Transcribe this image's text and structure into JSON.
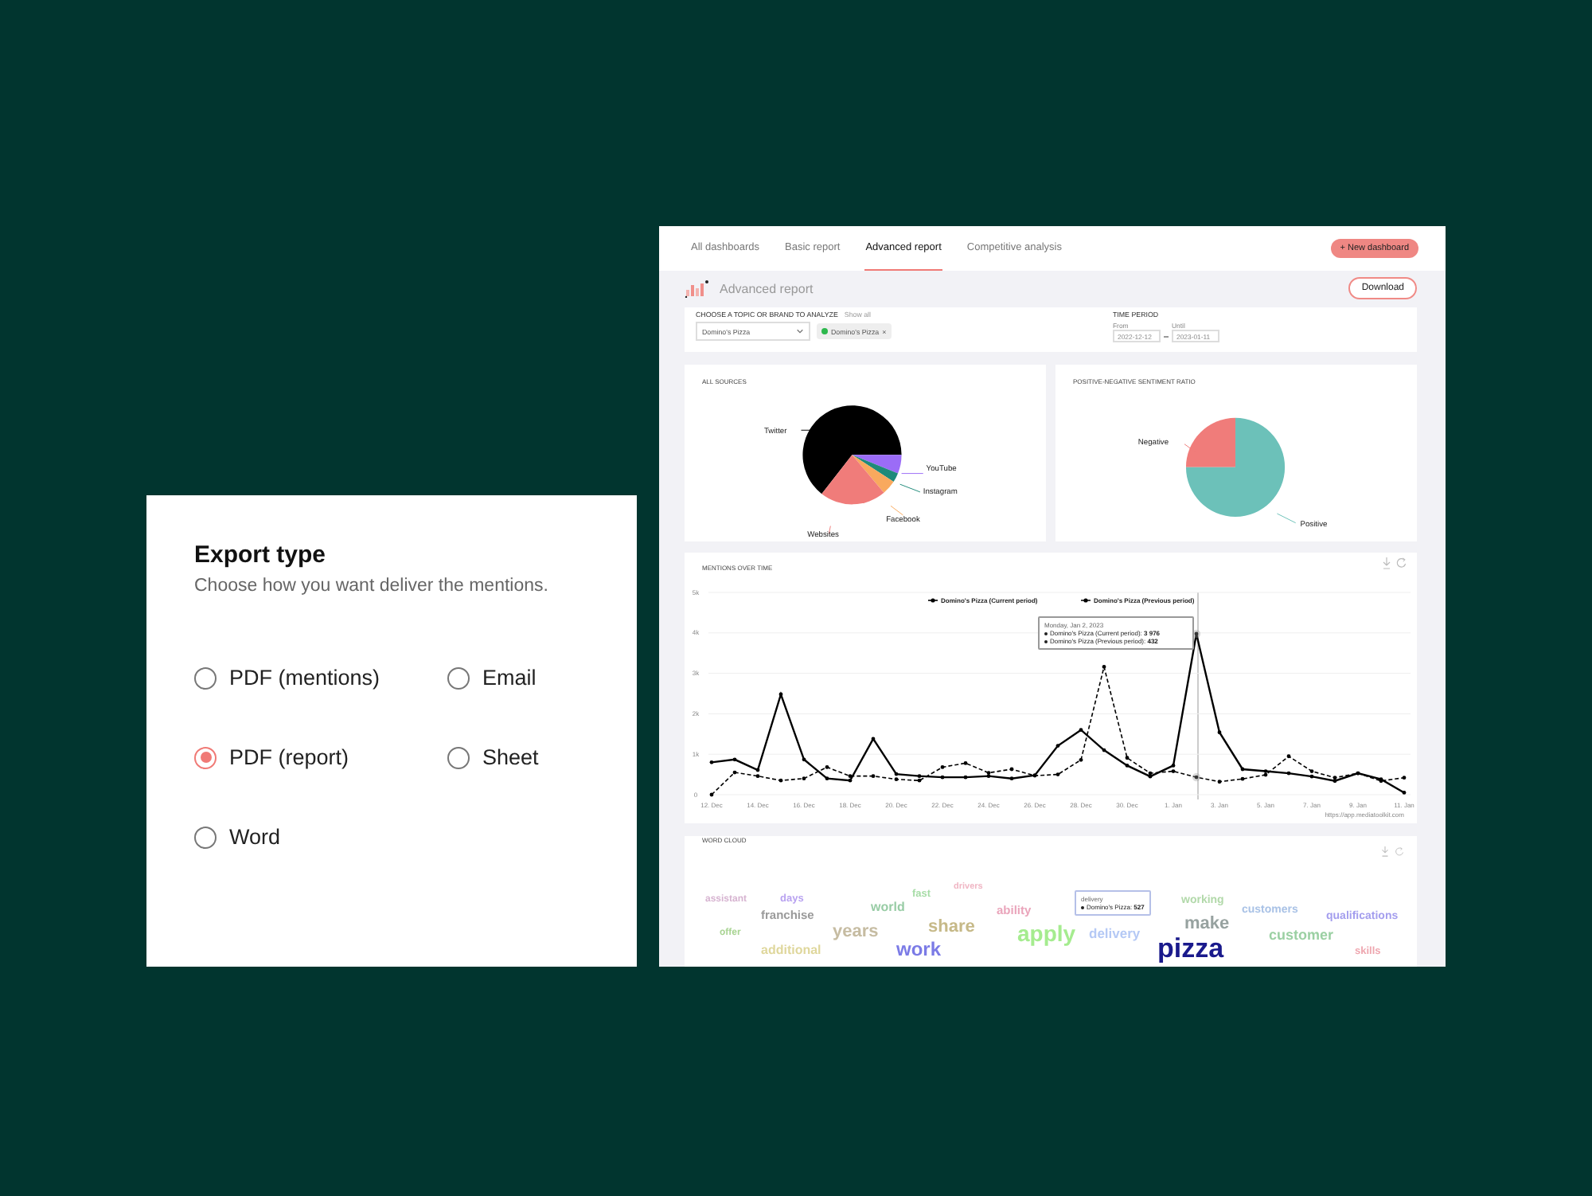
{
  "export_dialog": {
    "title": "Export type",
    "subtitle": "Choose how you want deliver the mentions.",
    "options": [
      {
        "label": "PDF (mentions)",
        "selected": false
      },
      {
        "label": "Email",
        "selected": false
      },
      {
        "label": "PDF (report)",
        "selected": true
      },
      {
        "label": "Sheet",
        "selected": false
      },
      {
        "label": "Word",
        "selected": false
      }
    ]
  },
  "dashboard": {
    "tabs": [
      {
        "label": "All dashboards",
        "selected": false
      },
      {
        "label": "Basic report",
        "selected": false
      },
      {
        "label": "Advanced report",
        "selected": true
      },
      {
        "label": "Competitive analysis",
        "selected": false
      }
    ],
    "new_button": "+ New dashboard",
    "page_title": "Advanced report",
    "download_button": "Download",
    "filters": {
      "topic_label": "CHOOSE A TOPIC OR BRAND TO ANALYZE",
      "show_all": "Show all",
      "topic_select": "Domino's Pizza",
      "chip": "Domino's Pizza",
      "chip_remove": "×",
      "period_label": "TIME PERIOD",
      "from_label": "From",
      "from_value": "2022-12-12",
      "until_label": "Until",
      "until_value": "2023-01-11"
    },
    "sources_card": {
      "title": "ALL SOURCES",
      "slices": [
        {
          "label": "Twitter",
          "color": "#000000"
        },
        {
          "label": "YouTube",
          "color": "#9b6cf7"
        },
        {
          "label": "Instagram",
          "color": "#1f8a7a"
        },
        {
          "label": "Facebook",
          "color": "#f9a95e"
        },
        {
          "label": "Websites",
          "color": "#f07c7a"
        }
      ]
    },
    "sentiment_card": {
      "title": "POSITIVE-NEGATIVE SENTIMENT RATIO",
      "slices": [
        {
          "label": "Negative",
          "color": "#f07c7a"
        },
        {
          "label": "Positive",
          "color": "#6cc1b9"
        }
      ]
    },
    "mentions_card": {
      "title": "MENTIONS OVER TIME",
      "chart_data": {
        "type": "line",
        "categories": [
          "12. Dec",
          null,
          "14. Dec",
          null,
          "16. Dec",
          null,
          "18. Dec",
          null,
          "20. Dec",
          null,
          "22. Dec",
          null,
          "24. Dec",
          null,
          "26. Dec",
          null,
          "28. Dec",
          null,
          "30. Dec",
          null,
          "1. Jan",
          null,
          "3. Jan",
          null,
          "5. Jan",
          null,
          "7. Jan",
          null,
          "9. Jan",
          null,
          "11. Jan"
        ],
        "grid": true,
        "legend": true,
        "series": [
          {
            "name": "Domino's Pizza (Current period)",
            "color": "#000000",
            "line_style": "solid",
            "values": [
              800,
              870,
              610,
              2480,
              870,
              400,
              350,
              1380,
              510,
              460,
              430,
              430,
              460,
              400,
              480,
              1210,
              1600,
              1100,
              720,
              450,
              720,
              3976,
              1540,
              630,
              580,
              530,
              450,
              340,
              530,
              380,
              50
            ]
          },
          {
            "name": "Domino's Pizza (Previous period)",
            "color": "#000000",
            "line_style": "dashed",
            "values": [
              0,
              550,
              460,
              350,
              400,
              680,
              460,
              460,
              380,
              350,
              680,
              780,
              540,
              630,
              470,
              500,
              860,
              3160,
              910,
              530,
              580,
              432,
              320,
              390,
              490,
              950,
              580,
              420,
              530,
              340,
              420
            ]
          }
        ],
        "yticks": [
          {
            "value": 0,
            "label": "0"
          },
          {
            "value": 1000,
            "label": "1k"
          },
          {
            "value": 2000,
            "label": "2k"
          },
          {
            "value": 3000,
            "label": "3k"
          },
          {
            "value": 4000,
            "label": "4k"
          },
          {
            "value": 5000,
            "label": "5k"
          }
        ],
        "ylim": [
          0,
          5000
        ]
      },
      "tooltip": {
        "date": "Monday, Jan 2, 2023",
        "lines": [
          "Domino's Pizza (Current period): **3 976**",
          "Domino's Pizza (Previous period): **432**"
        ]
      },
      "credit": "https://app.mediatoolkit.com"
    },
    "word_cloud": {
      "title": "WORD CLOUD",
      "words": [
        {
          "text": "assistant",
          "color": "#d6b3d0"
        },
        {
          "text": "days",
          "color": "#b8a2f0"
        },
        {
          "text": "fast",
          "color": "#a6dca6"
        },
        {
          "text": "drivers",
          "color": "#f0b6c4"
        },
        {
          "text": "working",
          "color": "#b2d9aa"
        },
        {
          "text": "franchise",
          "color": "#9a9a9a"
        },
        {
          "text": "world",
          "color": "#98cca5"
        },
        {
          "text": "ability",
          "color": "#eaa5bb"
        },
        {
          "text": "customers",
          "color": "#a9c2e6"
        },
        {
          "text": "qualifications",
          "color": "#a49eee"
        },
        {
          "text": "offer",
          "color": "#a9d493"
        },
        {
          "text": "years",
          "color": "#c6bca2"
        },
        {
          "text": "share",
          "color": "#c6b988"
        },
        {
          "text": "apply",
          "color": "#a5ec8f"
        },
        {
          "text": "delivery",
          "color": "#b5c9f5"
        },
        {
          "text": "make",
          "color": "#97a2a0"
        },
        {
          "text": "customer",
          "color": "#9bd0a3"
        },
        {
          "text": "additional",
          "color": "#dfd79c"
        },
        {
          "text": "work",
          "color": "#7b7be6"
        },
        {
          "text": "pizza",
          "color": "#1a1a8c"
        },
        {
          "text": "skills",
          "color": "#eea6af"
        }
      ],
      "tooltip": {
        "word": "delivery",
        "line": "Domino's Pizza: **527**"
      }
    }
  }
}
